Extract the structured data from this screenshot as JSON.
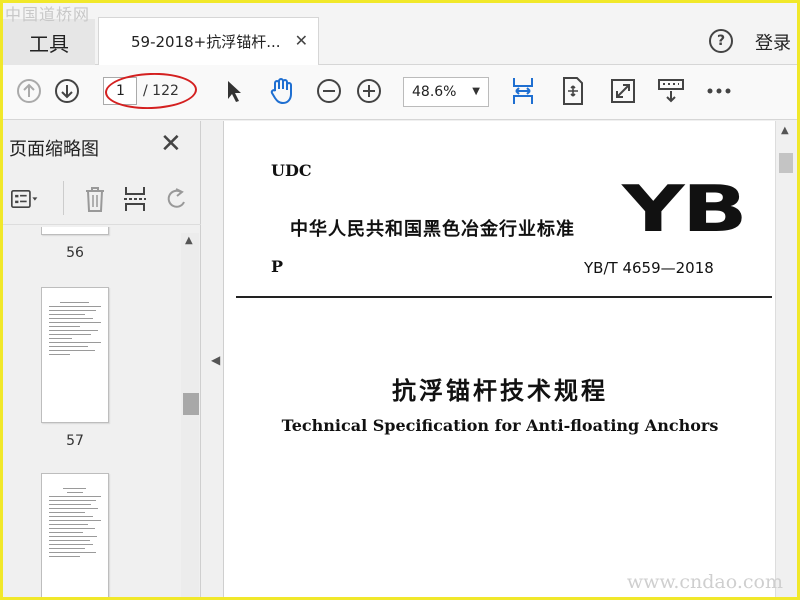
{
  "watermarks": {
    "top": "中国道桥网",
    "bottom": "www.cndao.com"
  },
  "tabbar": {
    "tools_label": "工具",
    "doc_tab_label": "59-2018+抗浮锚杆...",
    "login_label": "登录"
  },
  "toolbar": {
    "current_page": "1",
    "total_pages": "/ 122",
    "zoom": "48.6%"
  },
  "panel": {
    "title": "页面缩略图",
    "thumbnails": [
      {
        "label": "56"
      },
      {
        "label": "57"
      }
    ]
  },
  "document": {
    "udc": "UDC",
    "standard_name": "中华人民共和国黑色冶金行业标准",
    "logo": "YB",
    "p": "P",
    "code": "YB/T 4659—2018",
    "title_zh": "抗浮锚杆技术规程",
    "title_en": "Technical Specification for Anti-floating Anchors"
  },
  "colors": {
    "accent_blue": "#1f6fd1",
    "annotation_red": "#d42020",
    "frame_yellow": "#f1e82a"
  }
}
